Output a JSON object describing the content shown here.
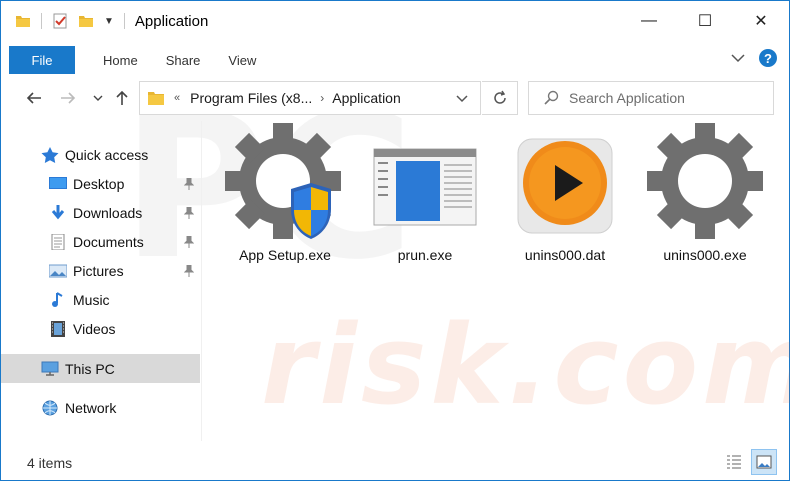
{
  "window": {
    "title": "Application",
    "minimize_glyph": "—",
    "maximize_glyph": "☐",
    "close_glyph": "✕"
  },
  "ribbon": {
    "file_label": "File",
    "tabs": [
      "Home",
      "Share",
      "View"
    ],
    "help_label": "?"
  },
  "address_bar": {
    "breadcrumbs": [
      "Program Files (x8...",
      "Application"
    ],
    "overflow_glyph": "«"
  },
  "search": {
    "placeholder": "Search Application"
  },
  "sidebar": {
    "quick_access": "Quick access",
    "items": [
      {
        "label": "Desktop",
        "icon": "desktop-icon",
        "pinned": true
      },
      {
        "label": "Downloads",
        "icon": "downloads-icon",
        "pinned": true
      },
      {
        "label": "Documents",
        "icon": "documents-icon",
        "pinned": true
      },
      {
        "label": "Pictures",
        "icon": "pictures-icon",
        "pinned": true
      },
      {
        "label": "Music",
        "icon": "music-icon",
        "pinned": false
      },
      {
        "label": "Videos",
        "icon": "videos-icon",
        "pinned": false
      }
    ],
    "this_pc": "This PC",
    "network": "Network"
  },
  "files": [
    {
      "name": "App Setup.exe",
      "icon": "gear-shield-icon"
    },
    {
      "name": "prun.exe",
      "icon": "window-app-icon"
    },
    {
      "name": "unins000.dat",
      "icon": "play-media-icon"
    },
    {
      "name": "unins000.exe",
      "icon": "gear-icon"
    }
  ],
  "status": {
    "count": "4 items"
  },
  "colors": {
    "accent": "#1979ca",
    "selected_bg": "#d9d9d9",
    "gear": "#6f6f6f",
    "media_orange": "#f08b1a"
  },
  "watermark": {
    "text": "risk.com",
    "logo": "PC"
  }
}
